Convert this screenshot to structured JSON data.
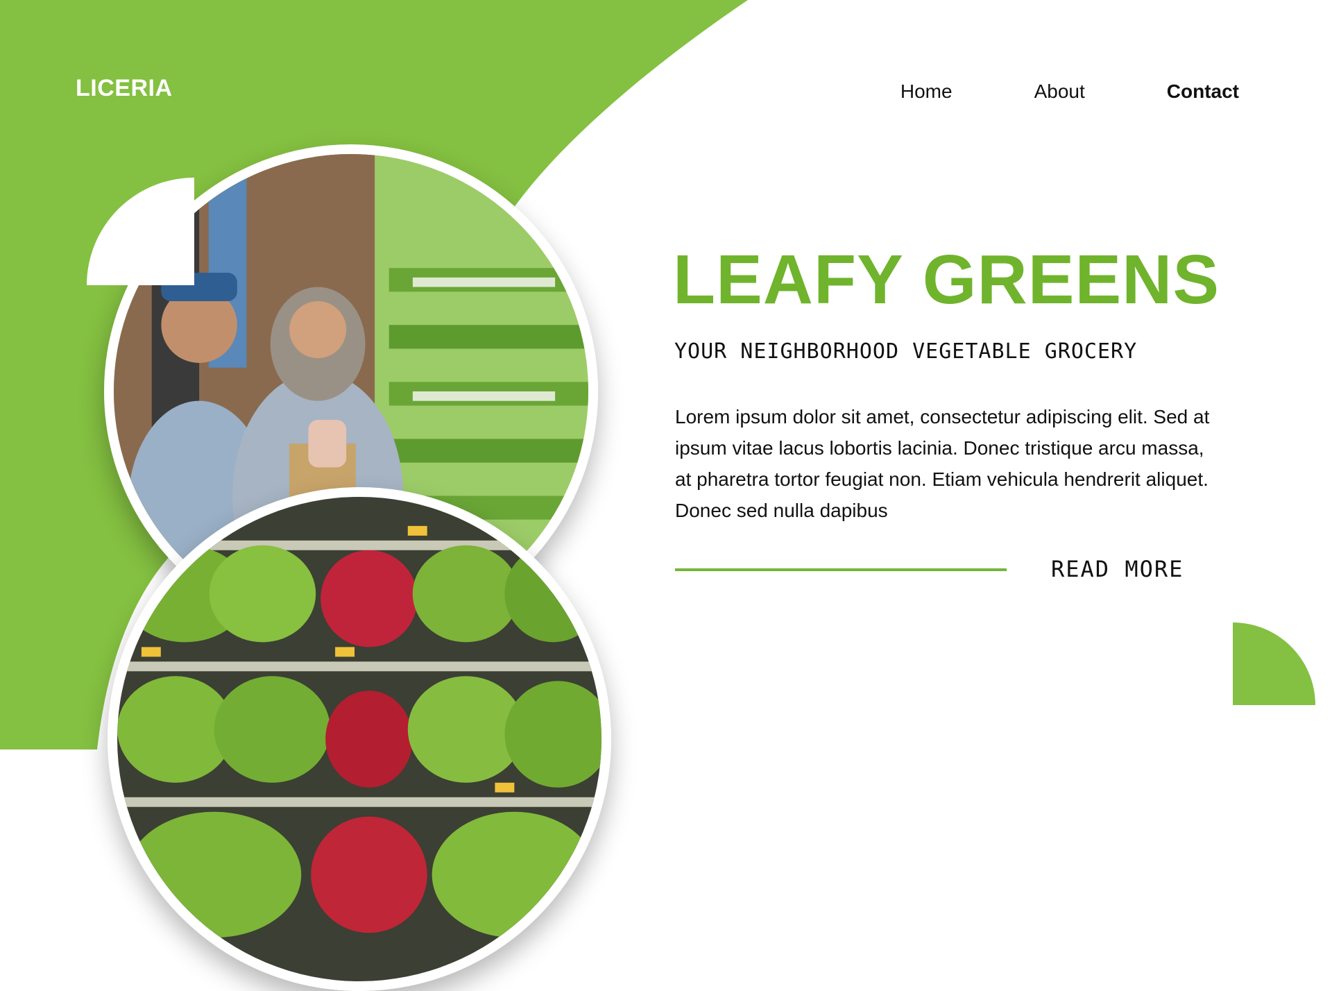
{
  "brand": {
    "name": "LICERIA"
  },
  "nav": {
    "items": [
      {
        "label": "Home"
      },
      {
        "label": "About"
      },
      {
        "label": "Contact"
      }
    ],
    "active": "Contact"
  },
  "hero": {
    "headline": "LEAFY GREENS",
    "subtitle": "YOUR NEIGHBORHOOD VEGETABLE GROCERY",
    "body": "Lorem ipsum dolor sit amet, consectetur adipiscing elit. Sed at ipsum vitae lacus lobortis lacinia. Donec tristique arcu massa, at pharetra tortor feugiat non. Etiam vehicula hendrerit aliquet. Donec sed nulla dapibus",
    "cta_label": "READ MORE"
  },
  "photos": [
    {
      "icon": "shoppers-photo"
    },
    {
      "icon": "produce-shelf-photo"
    }
  ],
  "colors": {
    "accent": "#84c041",
    "headline": "#6fb42c",
    "text": "#111111",
    "background": "#ffffff"
  }
}
